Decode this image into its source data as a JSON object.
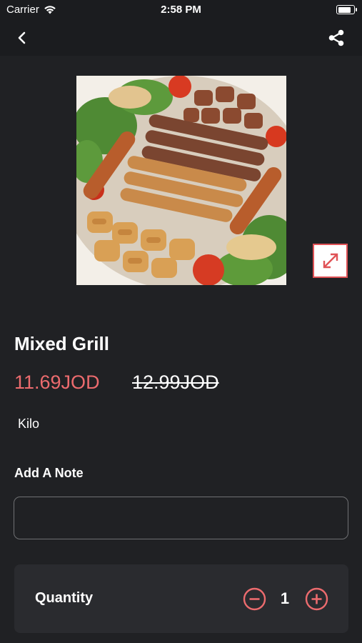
{
  "status_bar": {
    "carrier": "Carrier",
    "time": "2:58 PM",
    "battery_level": 0.85
  },
  "nav": {
    "back_icon": "chevron-left-icon",
    "share_icon": "share-icon"
  },
  "product": {
    "image_alt": "Mixed Grill",
    "name": "Mixed Grill",
    "price": "11.69JOD",
    "old_price": "12.99JOD",
    "unit": "Kilo",
    "expand_icon": "expand-arrows-icon"
  },
  "note": {
    "label": "Add A Note",
    "value": "",
    "placeholder": ""
  },
  "quantity": {
    "label": "Quantity",
    "value": "1",
    "minus_icon": "minus-circle-icon",
    "plus_icon": "plus-circle-icon"
  },
  "colors": {
    "background": "#202124",
    "bar": "#1b1c1f",
    "accent": "#ec6b6e",
    "card": "#2a2b2f"
  }
}
